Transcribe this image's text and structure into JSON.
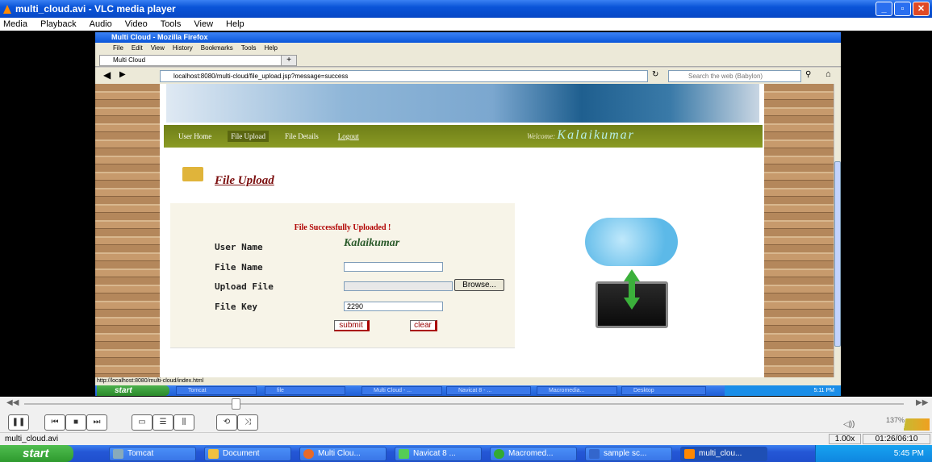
{
  "vlc": {
    "title": "multi_cloud.avi - VLC media player",
    "menu": [
      "Media",
      "Playback",
      "Audio",
      "Video",
      "Tools",
      "View",
      "Help"
    ],
    "filename": "multi_cloud.avi",
    "speed": "1.00x",
    "time": "01:26/06:10",
    "volume": "137%",
    "seek_progress": 0.24
  },
  "firefox": {
    "title": "Multi Cloud - Mozilla Firefox",
    "menu": [
      "File",
      "Edit",
      "View",
      "History",
      "Bookmarks",
      "Tools",
      "Help"
    ],
    "tab": "Multi Cloud",
    "new_tab": "+",
    "url": "localhost:8080/multi-cloud/file_upload.jsp?message=success",
    "search_placeholder": "Search the web (Babylon)",
    "status_url": "http://localhost:8080/multi-cloud/index.html"
  },
  "site": {
    "nav": [
      "User Home",
      "File Upload",
      "File Details",
      "Logout"
    ],
    "welcome_label": "Welcome:",
    "welcome_user": "Kalaikumar",
    "page_title": "File Upload",
    "success_message": "File Successfully Uploaded !",
    "labels": {
      "user_name": "User Name",
      "file_name": "File Name",
      "upload_file": "Upload File",
      "file_key": "File Key"
    },
    "user_name_value": "Kalaikumar",
    "file_key_value": "2290",
    "browse": "Browse...",
    "submit": "submit",
    "clear": "clear"
  },
  "inner_taskbar": {
    "start": "start",
    "items": [
      "Tomcat",
      "file",
      "Multi Cloud - ...",
      "Navicat 8 - ...",
      "Macromedia...",
      "Desktop"
    ],
    "clock": "5:11 PM"
  },
  "taskbar": {
    "start": "start",
    "items": [
      "Tomcat",
      "Document",
      "Multi Clou...",
      "Navicat 8 ...",
      "Macromed...",
      "sample sc...",
      "multi_clou..."
    ],
    "clock": "5:45 PM"
  }
}
